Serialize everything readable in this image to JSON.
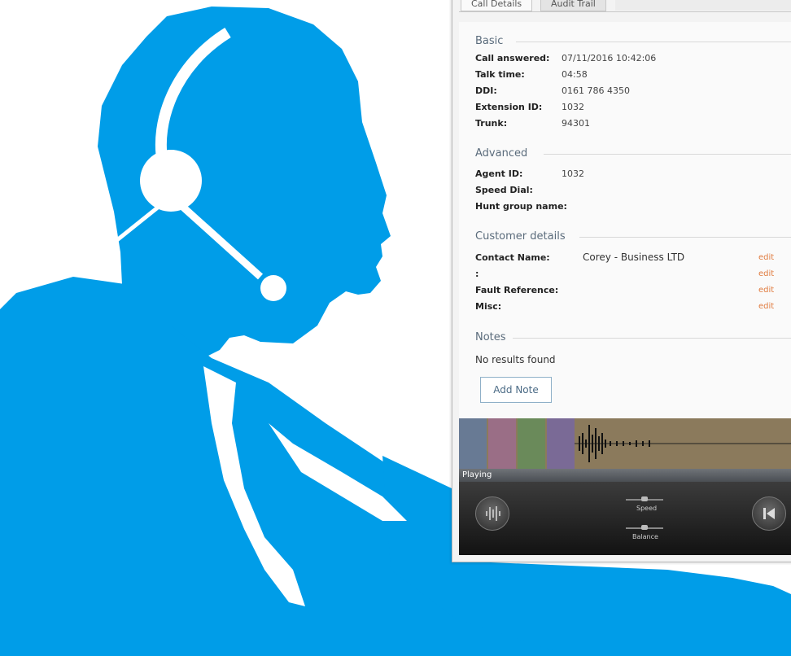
{
  "tabs": [
    "Call Details",
    "Audit Trail"
  ],
  "sections": {
    "basic": {
      "title": "Basic",
      "rows": [
        {
          "label": "Call answered:",
          "value": "07/11/2016 10:42:06"
        },
        {
          "label": "Talk time:",
          "value": "04:58"
        },
        {
          "label": "DDI:",
          "value": "0161 786 4350"
        },
        {
          "label": "Extension ID:",
          "value": "1032"
        },
        {
          "label": "Trunk:",
          "value": "94301"
        }
      ]
    },
    "advanced": {
      "title": "Advanced",
      "rows": [
        {
          "label": "Agent ID:",
          "value": "1032"
        },
        {
          "label": "Speed Dial:",
          "value": ""
        },
        {
          "label": "Hunt group name:",
          "value": ""
        }
      ]
    },
    "customer": {
      "title": "Customer details",
      "edit_label": "edit",
      "rows": [
        {
          "label": "Contact Name:",
          "value": "Corey - Business LTD"
        },
        {
          "label": ":",
          "value": ""
        },
        {
          "label": "Fault Reference:",
          "value": ""
        },
        {
          "label": "Misc:",
          "value": ""
        }
      ]
    },
    "notes": {
      "title": "Notes",
      "empty_text": "No results found",
      "add_button": "Add Note"
    }
  },
  "player": {
    "status": "Playing",
    "speed_label": "Speed",
    "balance_label": "Balance"
  },
  "colors": {
    "silhouette": "#009de8",
    "edit_link": "#e07b3f",
    "section_title": "#5a6b7b"
  },
  "icons": [
    "headset-silhouette",
    "waveform-icon",
    "skip-back-icon"
  ]
}
